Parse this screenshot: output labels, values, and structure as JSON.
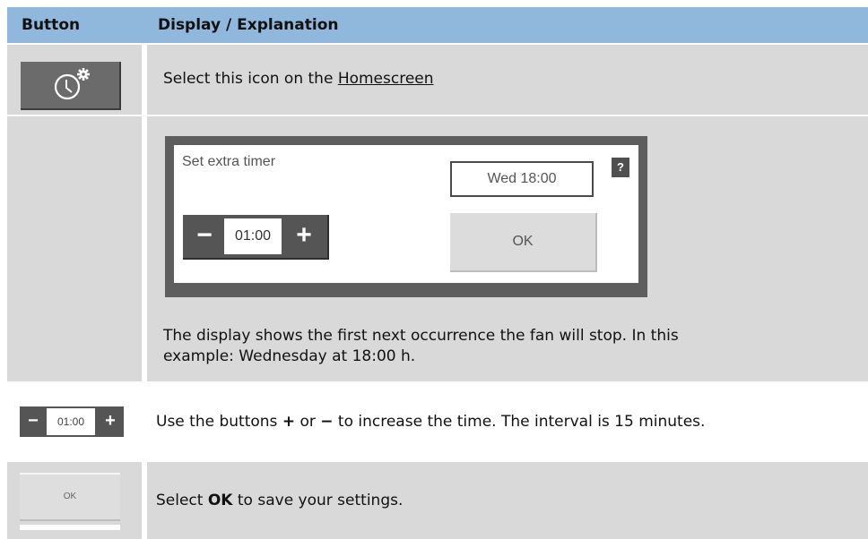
{
  "header": {
    "col1": "Button",
    "col2": "Display / Explanation"
  },
  "row1": {
    "icon": "clock-settings-icon",
    "text_before": "Select this icon on the ",
    "link": "Homescreen"
  },
  "row2": {
    "panel": {
      "title": "Set extra timer",
      "help": "?",
      "time_display": "Wed 18:00",
      "stepper_minus": "−",
      "stepper_value": "01:00",
      "stepper_plus": "+",
      "ok": "OK"
    },
    "text_line1": "The display shows the first next occurrence the fan will stop. In this",
    "text_line2": "example: Wednesday at 18:00 h."
  },
  "row3": {
    "stepper_minus": "−",
    "stepper_value": "01:00",
    "stepper_plus": "+",
    "text_a": "Use the buttons ",
    "plus": "+",
    "text_or": " or ",
    "minus": "−",
    "text_b": " to increase the time. The interval is 15 minutes."
  },
  "row4": {
    "ok": "OK",
    "text_a": "Select ",
    "ok_bold": "OK",
    "text_b": " to save your settings."
  }
}
